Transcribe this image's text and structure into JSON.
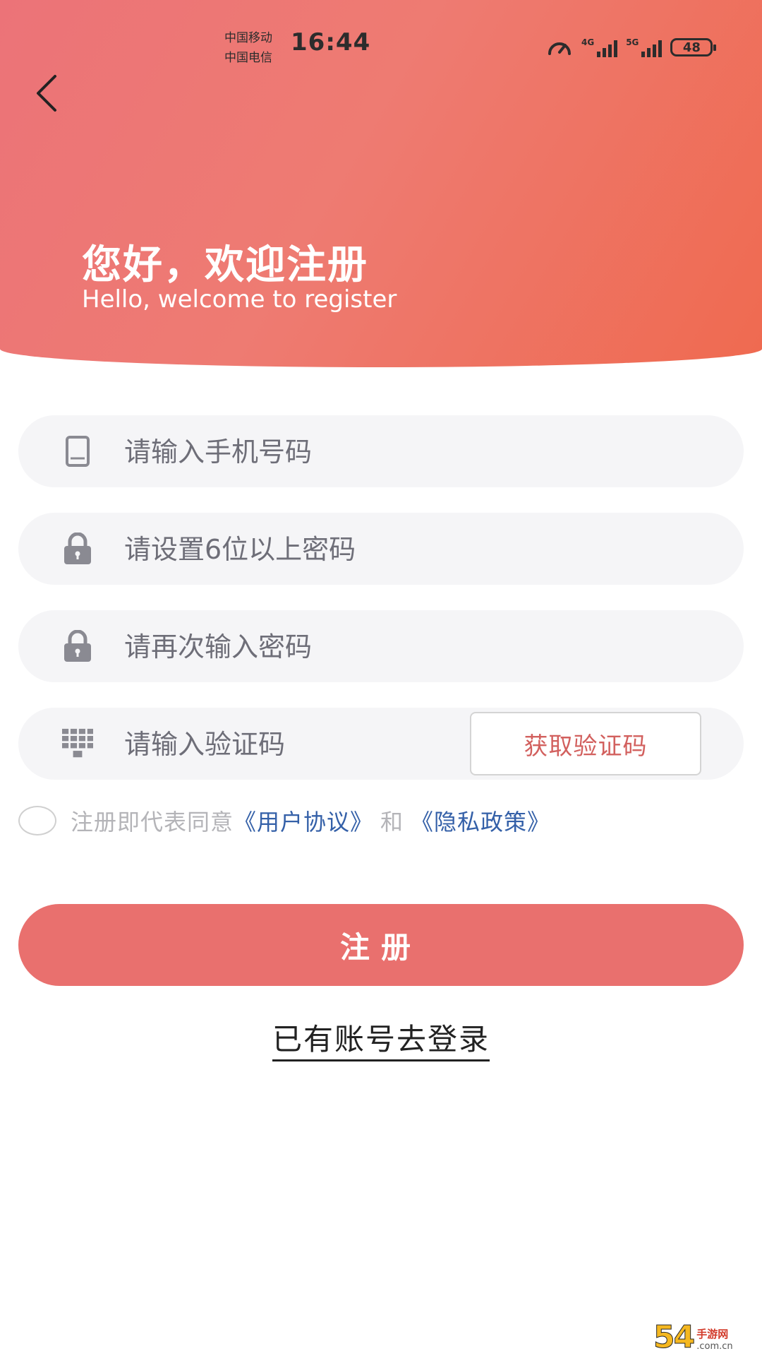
{
  "status_bar": {
    "carrier_1": "中国移动",
    "carrier_2": "中国电信",
    "time": "16:44",
    "network_1": "4G",
    "network_2": "5G",
    "battery": "48"
  },
  "header": {
    "back_icon": "chevron-left-icon",
    "title": "您好，欢迎注册",
    "subtitle": "Hello, welcome to register",
    "colors": {
      "gradient_start": "#ec7378",
      "gradient_end": "#ef6a50"
    }
  },
  "form": {
    "phone": {
      "icon": "phone-icon",
      "placeholder": "请输入手机号码",
      "value": ""
    },
    "password": {
      "icon": "lock-icon",
      "placeholder": "请设置6位以上密码",
      "value": ""
    },
    "confirm_password": {
      "icon": "lock-icon",
      "placeholder": "请再次输入密码",
      "value": ""
    },
    "code": {
      "icon": "keypad-icon",
      "placeholder": "请输入验证码",
      "value": "",
      "button_label": "获取验证码"
    }
  },
  "agreement": {
    "checked": false,
    "prefix": "注册即代表同意",
    "user_agreement": "《用户协议》",
    "connector": "和",
    "privacy_policy": "《隐私政策》",
    "link_color": "#3460a8"
  },
  "register_button": {
    "label": "注册",
    "color": "#e9706e"
  },
  "login_link": "已有账号去登录",
  "watermark": {
    "brand": "54",
    "cn": "手游网",
    "domain": ".com.cn"
  }
}
